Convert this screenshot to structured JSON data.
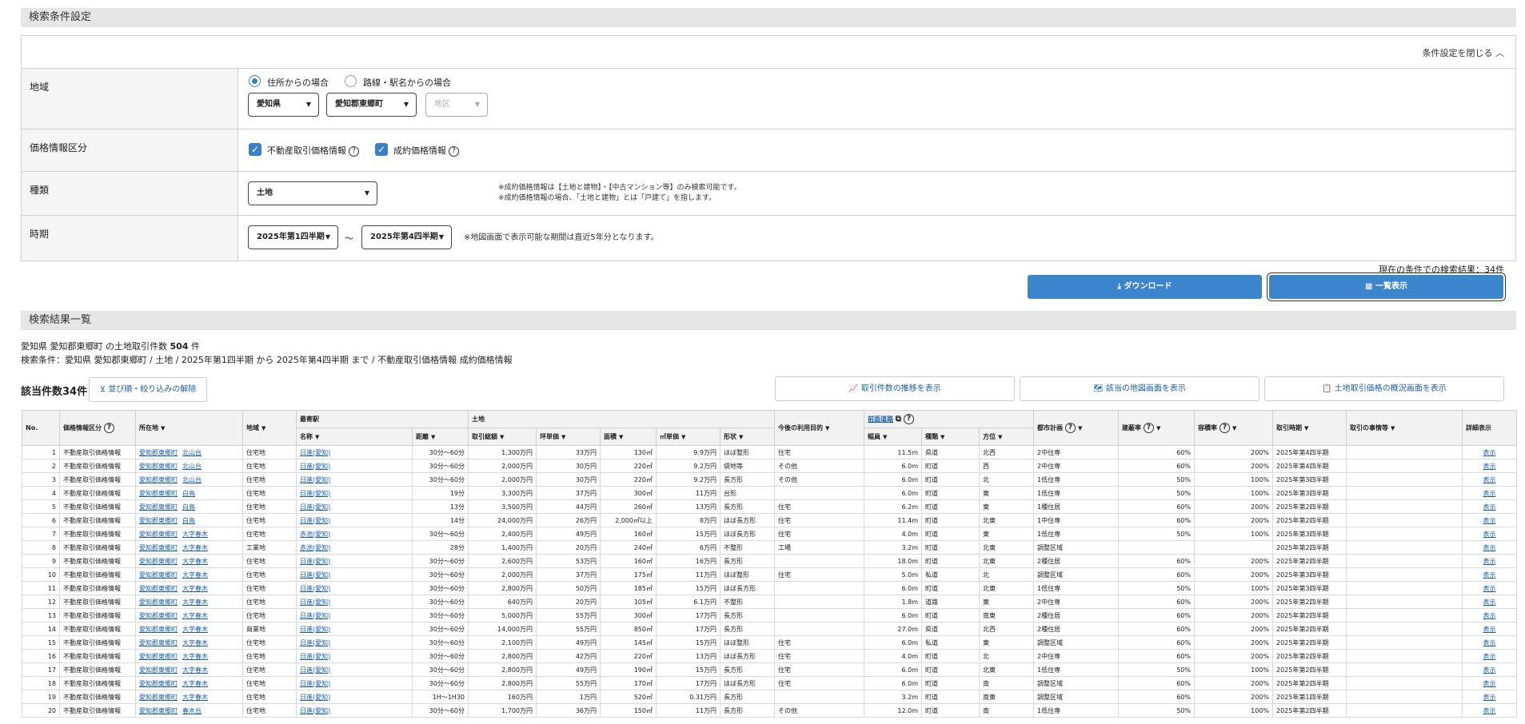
{
  "cond_header": "検索条件設定",
  "close_conditions": "条件設定を閉じる ︿",
  "region": {
    "label": "地域",
    "radio_address": "住所からの場合",
    "radio_station": "路線・駅名からの場合",
    "pref": "愛知県",
    "city": "愛知郡東郷町",
    "district": "地区"
  },
  "price_type": {
    "label": "価格情報区分",
    "opt1": "不動産取引価格情報",
    "opt2": "成約価格情報"
  },
  "kind": {
    "label": "種類",
    "value": "土地",
    "note1": "※成約価格情報は【土地と建物】・【中古マンション等】のみ検索可能です。",
    "note2": "※成約価格情報の場合、「土地と建物」とは「戸建て」を指します。"
  },
  "period": {
    "label": "時期",
    "from": "2025年第1四半期",
    "to": "2025年第4四半期",
    "tilde": "～",
    "note": "※地図画面で表示可能な期間は直近5年分となります。"
  },
  "current_results": "現在の条件での検索結果：34件",
  "download_label": "⤓ ダウンロード",
  "list_view_label": "▦ 一覧表示",
  "results_header": "検索結果一覧",
  "summary_line1a": "愛知県 愛知郡東郷町 の土地取引件数 ",
  "summary_count": "504",
  "summary_line1b": " 件",
  "summary_line2": "検索条件：愛知県 愛知郡東郷町 / 土地 / 2025年第1四半期 から 2025年第4四半期 まで / 不動産取引価格情報 成約価格情報",
  "hit_count": "該当件数34件",
  "clear_filter": "⊻ 並び順・絞り込みの解除",
  "trend_btn": "📈 取引件数の推移を表示",
  "map_btn": "🗺 該当の地図画面を表示",
  "overview_btn": "📋 土地取引価格の概況画面を表示",
  "th": {
    "no": "No.",
    "type": "価格情報区分",
    "loc": "所在地",
    "area": "地域",
    "station_group": "最寄駅",
    "station": "名称",
    "dist": "距離",
    "land_group": "土地",
    "total": "取引総額",
    "tsubo": "坪単価",
    "menseki": "面積",
    "sqm": "㎡単価",
    "shape": "形状",
    "use": "今後の利用目的",
    "road_group": "前面道路",
    "width": "幅員",
    "rtype": "種類",
    "dir": "方位",
    "plan": "都市計画",
    "bcr": "建蔽率",
    "far": "容積率",
    "time": "取引時期",
    "circ": "取引の事情等",
    "detail": "詳細表示"
  },
  "rows": [
    {
      "no": "1",
      "type": "不動産取引価格情報",
      "city": "愛知郡東郷町",
      "town": "北山台",
      "area": "住宅地",
      "station": "日進(愛知)",
      "dist": "30分〜60分",
      "total": "1,300万円",
      "tsubo": "33万円",
      "menseki": "130㎡",
      "sqm": "9.9万円",
      "shape": "ほぼ整形",
      "use": "住宅",
      "width": "11.5m",
      "rtype": "県道",
      "dir": "北西",
      "plan": "2中住専",
      "bcr": "60%",
      "far": "200%",
      "time": "2025年第4四半期",
      "circ": "",
      "detail": "表示"
    },
    {
      "no": "2",
      "type": "不動産取引価格情報",
      "city": "愛知郡東郷町",
      "town": "北山台",
      "area": "住宅地",
      "station": "日進(愛知)",
      "dist": "30分〜60分",
      "total": "2,000万円",
      "tsubo": "30万円",
      "menseki": "220㎡",
      "sqm": "9.2万円",
      "shape": "袋地等",
      "use": "その他",
      "width": "6.0m",
      "rtype": "町道",
      "dir": "西",
      "plan": "2中住専",
      "bcr": "60%",
      "far": "200%",
      "time": "2025年第4四半期",
      "circ": "",
      "detail": "表示"
    },
    {
      "no": "3",
      "type": "不動産取引価格情報",
      "city": "愛知郡東郷町",
      "town": "北山台",
      "area": "住宅地",
      "station": "日進(愛知)",
      "dist": "30分〜60分",
      "total": "2,000万円",
      "tsubo": "30万円",
      "menseki": "220㎡",
      "sqm": "9.2万円",
      "shape": "長方形",
      "use": "その他",
      "width": "6.0m",
      "rtype": "町道",
      "dir": "北",
      "plan": "1低住専",
      "bcr": "50%",
      "far": "100%",
      "time": "2025年第3四半期",
      "circ": "",
      "detail": "表示"
    },
    {
      "no": "4",
      "type": "不動産取引価格情報",
      "city": "愛知郡東郷町",
      "town": "白鳥",
      "area": "住宅地",
      "station": "日進(愛知)",
      "dist": "19分",
      "total": "3,300万円",
      "tsubo": "37万円",
      "menseki": "300㎡",
      "sqm": "11万円",
      "shape": "台形",
      "use": "",
      "width": "6.0m",
      "rtype": "町道",
      "dir": "東",
      "plan": "1低住専",
      "bcr": "50%",
      "far": "100%",
      "time": "2025年第3四半期",
      "circ": "",
      "detail": "表示"
    },
    {
      "no": "5",
      "type": "不動産取引価格情報",
      "city": "愛知郡東郷町",
      "town": "白鳥",
      "area": "住宅地",
      "station": "日進(愛知)",
      "dist": "13分",
      "total": "3,500万円",
      "tsubo": "44万円",
      "menseki": "260㎡",
      "sqm": "13万円",
      "shape": "長方形",
      "use": "住宅",
      "width": "6.2m",
      "rtype": "町道",
      "dir": "東",
      "plan": "1種住居",
      "bcr": "60%",
      "far": "200%",
      "time": "2025年第2四半期",
      "circ": "",
      "detail": "表示"
    },
    {
      "no": "6",
      "type": "不動産取引価格情報",
      "city": "愛知郡東郷町",
      "town": "白鳥",
      "area": "住宅地",
      "station": "日進(愛知)",
      "dist": "14分",
      "total": "24,000万円",
      "tsubo": "26万円",
      "menseki": "2,000㎡以上",
      "sqm": "8万円",
      "shape": "ほぼ長方形",
      "use": "住宅",
      "width": "11.4m",
      "rtype": "町道",
      "dir": "北東",
      "plan": "1中住専",
      "bcr": "60%",
      "far": "200%",
      "time": "2025年第2四半期",
      "circ": "",
      "detail": "表示"
    },
    {
      "no": "7",
      "type": "不動産取引価格情報",
      "city": "愛知郡東郷町",
      "town": "大字春木",
      "area": "住宅地",
      "station": "赤池(愛知)",
      "dist": "30分〜60分",
      "total": "2,400万円",
      "tsubo": "49万円",
      "menseki": "160㎡",
      "sqm": "15万円",
      "shape": "ほぼ長方形",
      "use": "住宅",
      "width": "4.0m",
      "rtype": "町道",
      "dir": "東",
      "plan": "1低住専",
      "bcr": "50%",
      "far": "100%",
      "time": "2025年第3四半期",
      "circ": "",
      "detail": "表示"
    },
    {
      "no": "8",
      "type": "不動産取引価格情報",
      "city": "愛知郡東郷町",
      "town": "大字春木",
      "area": "工業地",
      "station": "赤池(愛知)",
      "dist": "28分",
      "total": "1,400万円",
      "tsubo": "20万円",
      "menseki": "240㎡",
      "sqm": "6万円",
      "shape": "不整形",
      "use": "工場",
      "width": "3.2m",
      "rtype": "町道",
      "dir": "北東",
      "plan": "調整区域",
      "bcr": "",
      "far": "",
      "time": "2025年第2四半期",
      "circ": "",
      "detail": "表示"
    },
    {
      "no": "9",
      "type": "不動産取引価格情報",
      "city": "愛知郡東郷町",
      "town": "大字春木",
      "area": "住宅地",
      "station": "日進(愛知)",
      "dist": "30分〜60分",
      "total": "2,600万円",
      "tsubo": "53万円",
      "menseki": "160㎡",
      "sqm": "16万円",
      "shape": "長方形",
      "use": "",
      "width": "18.0m",
      "rtype": "町道",
      "dir": "北東",
      "plan": "2種住居",
      "bcr": "60%",
      "far": "200%",
      "time": "2025年第2四半期",
      "circ": "",
      "detail": "表示"
    },
    {
      "no": "10",
      "type": "不動産取引価格情報",
      "city": "愛知郡東郷町",
      "town": "大字春木",
      "area": "住宅地",
      "station": "日進(愛知)",
      "dist": "30分〜60分",
      "total": "2,000万円",
      "tsubo": "37万円",
      "menseki": "175㎡",
      "sqm": "11万円",
      "shape": "ほぼ整形",
      "use": "住宅",
      "width": "5.0m",
      "rtype": "私道",
      "dir": "北",
      "plan": "調整区域",
      "bcr": "60%",
      "far": "200%",
      "time": "2025年第3四半期",
      "circ": "",
      "detail": "表示"
    },
    {
      "no": "11",
      "type": "不動産取引価格情報",
      "city": "愛知郡東郷町",
      "town": "大字春木",
      "area": "住宅地",
      "station": "日進(愛知)",
      "dist": "30分〜60分",
      "total": "2,800万円",
      "tsubo": "50万円",
      "menseki": "185㎡",
      "sqm": "15万円",
      "shape": "ほぼ長方形",
      "use": "",
      "width": "6.0m",
      "rtype": "町道",
      "dir": "北東",
      "plan": "1低住専",
      "bcr": "50%",
      "far": "100%",
      "time": "2025年第3四半期",
      "circ": "",
      "detail": "表示"
    },
    {
      "no": "12",
      "type": "不動産取引価格情報",
      "city": "愛知郡東郷町",
      "town": "大字春木",
      "area": "住宅地",
      "station": "日進(愛知)",
      "dist": "30分〜60分",
      "total": "640万円",
      "tsubo": "20万円",
      "menseki": "105㎡",
      "sqm": "6.1万円",
      "shape": "不整形",
      "use": "",
      "width": "1.8m",
      "rtype": "道路",
      "dir": "東",
      "plan": "2中住専",
      "bcr": "60%",
      "far": "200%",
      "time": "2025年第2四半期",
      "circ": "",
      "detail": "表示"
    },
    {
      "no": "13",
      "type": "不動産取引価格情報",
      "city": "愛知郡東郷町",
      "town": "大字春木",
      "area": "住宅地",
      "station": "日進(愛知)",
      "dist": "30分〜60分",
      "total": "5,000万円",
      "tsubo": "55万円",
      "menseki": "300㎡",
      "sqm": "17万円",
      "shape": "長方形",
      "use": "",
      "width": "6.0m",
      "rtype": "町道",
      "dir": "南東",
      "plan": "2種住居",
      "bcr": "60%",
      "far": "200%",
      "time": "2025年第2四半期",
      "circ": "",
      "detail": "表示"
    },
    {
      "no": "14",
      "type": "不動産取引価格情報",
      "city": "愛知郡東郷町",
      "town": "大字春木",
      "area": "商業地",
      "station": "日進(愛知)",
      "dist": "30分〜60分",
      "total": "14,000万円",
      "tsubo": "55万円",
      "menseki": "850㎡",
      "sqm": "17万円",
      "shape": "長方形",
      "use": "",
      "width": "27.0m",
      "rtype": "県道",
      "dir": "北西",
      "plan": "2種住居",
      "bcr": "60%",
      "far": "200%",
      "time": "2025年第2四半期",
      "circ": "",
      "detail": "表示"
    },
    {
      "no": "15",
      "type": "不動産取引価格情報",
      "city": "愛知郡東郷町",
      "town": "大字春木",
      "area": "住宅地",
      "station": "日進(愛知)",
      "dist": "30分〜60分",
      "total": "2,100万円",
      "tsubo": "49万円",
      "menseki": "145㎡",
      "sqm": "15万円",
      "shape": "ほぼ整形",
      "use": "住宅",
      "width": "6.0m",
      "rtype": "私道",
      "dir": "東",
      "plan": "調整区域",
      "bcr": "60%",
      "far": "200%",
      "time": "2025年第2四半期",
      "circ": "",
      "detail": "表示"
    },
    {
      "no": "16",
      "type": "不動産取引価格情報",
      "city": "愛知郡東郷町",
      "town": "大字春木",
      "area": "住宅地",
      "station": "日進(愛知)",
      "dist": "30分〜60分",
      "total": "2,800万円",
      "tsubo": "42万円",
      "menseki": "220㎡",
      "sqm": "13万円",
      "shape": "ほぼ長方形",
      "use": "住宅",
      "width": "4.0m",
      "rtype": "町道",
      "dir": "北",
      "plan": "2中住専",
      "bcr": "60%",
      "far": "200%",
      "time": "2025年第2四半期",
      "circ": "",
      "detail": "表示"
    },
    {
      "no": "17",
      "type": "不動産取引価格情報",
      "city": "愛知郡東郷町",
      "town": "大字春木",
      "area": "住宅地",
      "station": "日進(愛知)",
      "dist": "30分〜60分",
      "total": "2,800万円",
      "tsubo": "49万円",
      "menseki": "190㎡",
      "sqm": "15万円",
      "shape": "長方形",
      "use": "住宅",
      "width": "6.0m",
      "rtype": "町道",
      "dir": "北東",
      "plan": "1低住専",
      "bcr": "50%",
      "far": "100%",
      "time": "2025年第2四半期",
      "circ": "",
      "detail": "表示"
    },
    {
      "no": "18",
      "type": "不動産取引価格情報",
      "city": "愛知郡東郷町",
      "town": "大字春木",
      "area": "住宅地",
      "station": "日進(愛知)",
      "dist": "30分〜60分",
      "total": "2,800万円",
      "tsubo": "55万円",
      "menseki": "170㎡",
      "sqm": "17万円",
      "shape": "ほぼ長方形",
      "use": "住宅",
      "width": "6.0m",
      "rtype": "町道",
      "dir": "南",
      "plan": "調整区域",
      "bcr": "60%",
      "far": "200%",
      "time": "2025年第2四半期",
      "circ": "",
      "detail": "表示"
    },
    {
      "no": "19",
      "type": "不動産取引価格情報",
      "city": "愛知郡東郷町",
      "town": "大字春木",
      "area": "住宅地",
      "station": "日進(愛知)",
      "dist": "1H〜1H30",
      "total": "160万円",
      "tsubo": "1万円",
      "menseki": "520㎡",
      "sqm": "0.31万円",
      "shape": "長方形",
      "use": "",
      "width": "3.2m",
      "rtype": "町道",
      "dir": "南東",
      "plan": "調整区域",
      "bcr": "60%",
      "far": "200%",
      "time": "2025年第1四半期",
      "circ": "",
      "detail": "表示"
    },
    {
      "no": "20",
      "type": "不動産取引価格情報",
      "city": "愛知郡東郷町",
      "town": "春木台",
      "area": "住宅地",
      "station": "日進(愛知)",
      "dist": "30分〜60分",
      "total": "1,700万円",
      "tsubo": "36万円",
      "menseki": "150㎡",
      "sqm": "11万円",
      "shape": "長方形",
      "use": "その他",
      "width": "12.0m",
      "rtype": "町道",
      "dir": "南",
      "plan": "1低住専",
      "bcr": "50%",
      "far": "100%",
      "time": "2025年第2四半期",
      "circ": "",
      "detail": "表示"
    }
  ]
}
